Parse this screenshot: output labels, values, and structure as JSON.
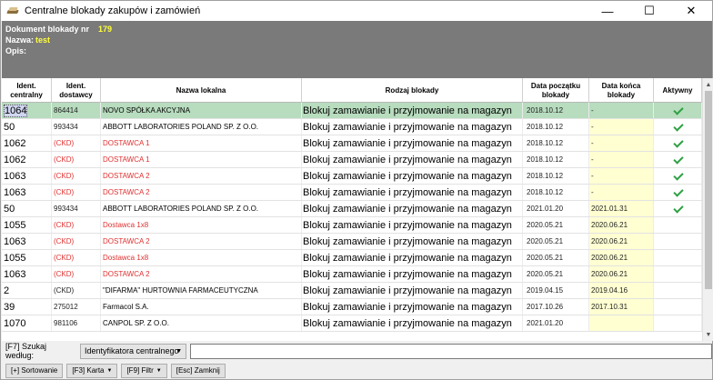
{
  "window": {
    "title": "Centralne blokady zakupów i zamówień",
    "minimize": "—",
    "maximize": "☐",
    "close": "✕"
  },
  "header": {
    "doc_label": "Dokument blokady nr",
    "doc_value": "179",
    "name_label": "Nazwa:",
    "name_value": "test",
    "desc_label": "Opis:"
  },
  "table": {
    "columns": [
      "Ident.\ncentralny",
      "Ident.\ndostawcy",
      "Nazwa lokalna",
      "Rodzaj blokady",
      "Data początku\nblokady",
      "Data końca\nblokady",
      "Aktywny"
    ],
    "rows": [
      {
        "c1": "1064",
        "c2": "864414",
        "c3": "NOVO SPÓŁKA AKCYJNA",
        "c4": "Blokuj zamawianie i przyjmowanie na magazyn",
        "c5": "2018.10.12",
        "c6": "-",
        "active": true,
        "red": false
      },
      {
        "c1": "50",
        "c2": "993434",
        "c3": "ABBOTT LABORATORIES POLAND SP. Z O.O.",
        "c4": "Blokuj zamawianie i przyjmowanie na magazyn",
        "c5": "2018.10.12",
        "c6": "-",
        "active": true,
        "red": false
      },
      {
        "c1": "1062",
        "c2": "(CKD)",
        "c3": "DOSTAWCA 1",
        "c4": "Blokuj zamawianie i przyjmowanie na magazyn",
        "c5": "2018.10.12",
        "c6": "-",
        "active": true,
        "red": true
      },
      {
        "c1": "1062",
        "c2": "(CKD)",
        "c3": "DOSTAWCA 1",
        "c4": "Blokuj zamawianie i przyjmowanie na magazyn",
        "c5": "2018.10.12",
        "c6": "-",
        "active": true,
        "red": true
      },
      {
        "c1": "1063",
        "c2": "(CKD)",
        "c3": "DOSTAWCA 2",
        "c4": "Blokuj zamawianie i przyjmowanie na magazyn",
        "c5": "2018.10.12",
        "c6": "-",
        "active": true,
        "red": true
      },
      {
        "c1": "1063",
        "c2": "(CKD)",
        "c3": "DOSTAWCA 2",
        "c4": "Blokuj zamawianie i przyjmowanie na magazyn",
        "c5": "2018.10.12",
        "c6": "-",
        "active": true,
        "red": true
      },
      {
        "c1": "50",
        "c2": "993434",
        "c3": "ABBOTT LABORATORIES POLAND SP. Z O.O.",
        "c4": "Blokuj zamawianie i przyjmowanie na magazyn",
        "c5": "2021.01.20",
        "c6": "2021.01.31",
        "active": true,
        "red": false
      },
      {
        "c1": "1055",
        "c2": "(CKD)",
        "c3": "Dostawca 1x8",
        "c4": "Blokuj zamawianie i przyjmowanie na magazyn",
        "c5": "2020.05.21",
        "c6": "2020.06.21",
        "active": false,
        "red": true
      },
      {
        "c1": "1063",
        "c2": "(CKD)",
        "c3": "DOSTAWCA 2",
        "c4": "Blokuj zamawianie i przyjmowanie na magazyn",
        "c5": "2020.05.21",
        "c6": "2020.06.21",
        "active": false,
        "red": true
      },
      {
        "c1": "1055",
        "c2": "(CKD)",
        "c3": "Dostawca 1x8",
        "c4": "Blokuj zamawianie i przyjmowanie na magazyn",
        "c5": "2020.05.21",
        "c6": "2020.06.21",
        "active": false,
        "red": true
      },
      {
        "c1": "1063",
        "c2": "(CKD)",
        "c3": "DOSTAWCA 2",
        "c4": "Blokuj zamawianie i przyjmowanie na magazyn",
        "c5": "2020.05.21",
        "c6": "2020.06.21",
        "active": false,
        "red": true
      },
      {
        "c1": "2",
        "c2": "(CKD)",
        "c3": "\"DIFARMA\" HURTOWNIA FARMACEUTYCZNA",
        "c4": "Blokuj zamawianie i przyjmowanie na magazyn",
        "c5": "2019.04.15",
        "c6": "2019.04.16",
        "active": false,
        "red": false
      },
      {
        "c1": "39",
        "c2": "275012",
        "c3": "Farmacol S.A.",
        "c4": "Blokuj zamawianie i przyjmowanie na magazyn",
        "c5": "2017.10.26",
        "c6": "2017.10.31",
        "active": false,
        "red": false
      },
      {
        "c1": "1070",
        "c2": "981106",
        "c3": "CANPOL SP. Z O.O.",
        "c4": "Blokuj zamawianie i przyjmowanie na magazyn",
        "c5": "2021.01.20",
        "c6": "",
        "active": false,
        "red": false
      }
    ]
  },
  "search": {
    "label": "[F7] Szukaj według:",
    "selected": "Identyfikatora centralnego",
    "value": ""
  },
  "buttons": {
    "sort": "[+] Sortowanie",
    "card": "[F3] Karta",
    "filter": "[F9] Filtr",
    "close": "[Esc] Zamknij"
  },
  "colors": {
    "header_bg": "#7a7a7a",
    "selected_row": "#b7dcbe",
    "end_date_bg": "#ffffd2",
    "red_text": "#e03030",
    "check": "#2ea043"
  }
}
